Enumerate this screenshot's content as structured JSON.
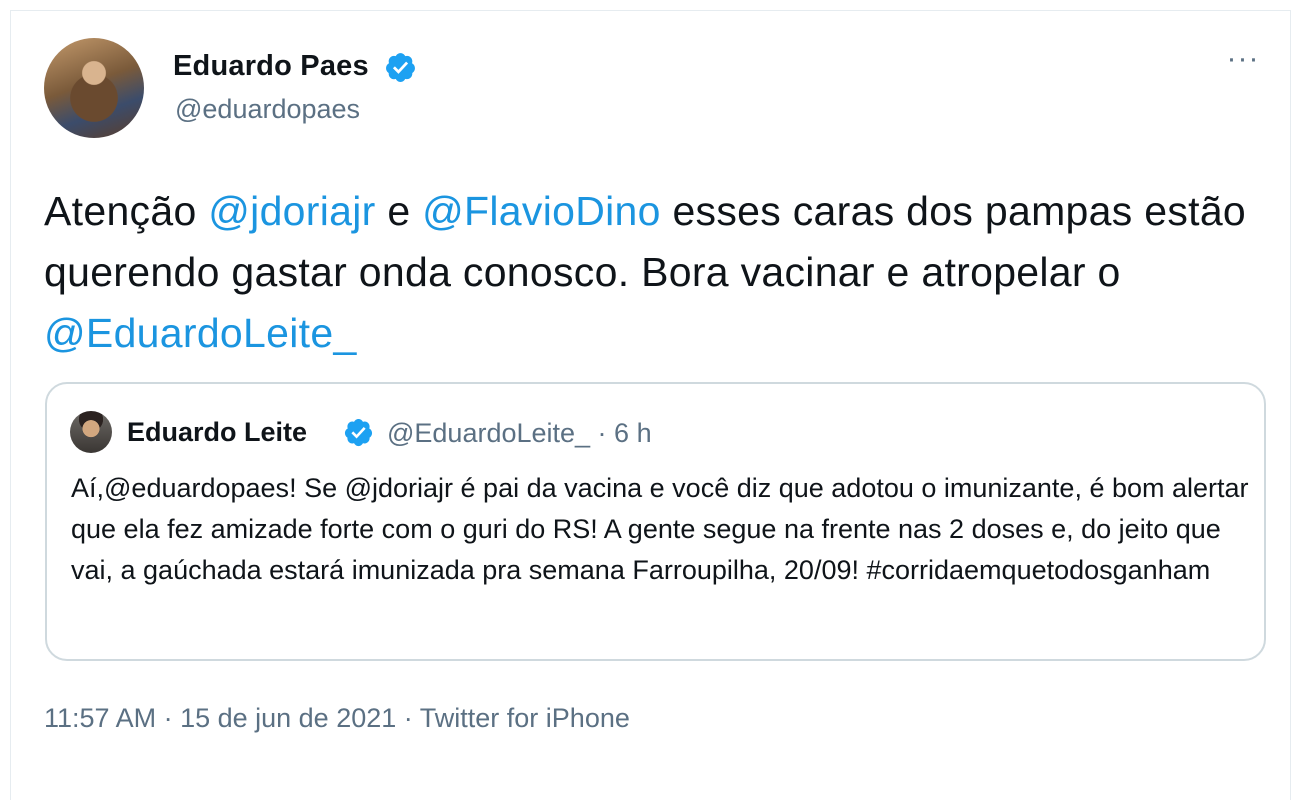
{
  "author": {
    "name": "Eduardo Paes",
    "handle": "@eduardopaes"
  },
  "more_label": "···",
  "tweet": {
    "parts": [
      "Atenção ",
      "@jdoriajr",
      " e ",
      "@FlavioDino",
      " esses caras dos pampas estão querendo gastar onda conosco.  Bora vacinar e atropelar o ",
      "@EduardoLeite_"
    ]
  },
  "quoted": {
    "name": "Eduardo Leite",
    "handle_time": "@EduardoLeite_ · 6 h",
    "parts": [
      "Aí,",
      "@eduardopaes",
      "! Se ",
      "@jdoriajr",
      " é pai da vacina e você diz que adotou o imunizante, é bom alertar que ela fez amizade forte com o guri do RS! A gente segue na frente nas 2 doses e, do jeito que vai, a gaúchada estará imunizada pra semana Farroupilha, 20/09! ",
      "#corridaemquetodosganham"
    ]
  },
  "meta": {
    "time_date": "11:57 AM · 15 de jun de 2021 · ",
    "source": "Twitter for iPhone"
  },
  "colors": {
    "link": "#1b95e0",
    "secondary_text": "#5b7083",
    "verified": "#1da1f2",
    "border": "#cfd9de"
  },
  "icons": {
    "verified": "verified-badge-icon",
    "more": "more-dots-icon"
  }
}
